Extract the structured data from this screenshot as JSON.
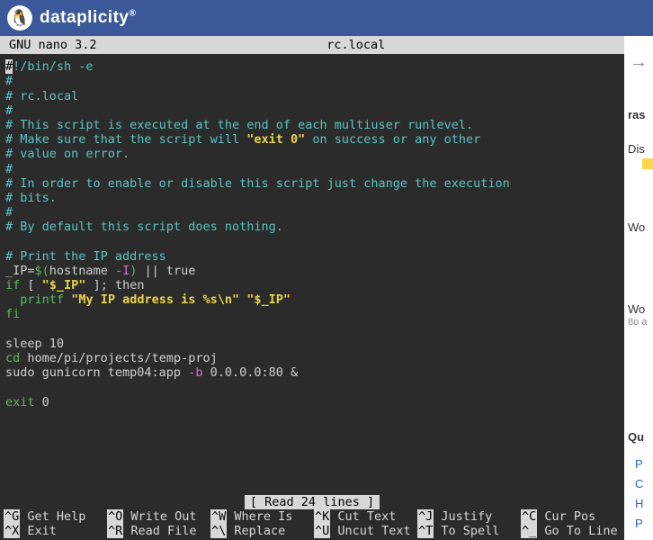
{
  "header": {
    "brand": "dataplicity",
    "reg": "®"
  },
  "titlebar": {
    "left": "GNU nano 3.2",
    "center": "rc.local"
  },
  "editor": {
    "shebang_hash": "#",
    "shebang_rest": "!/bin/sh -e",
    "l2": "#",
    "l3": "# rc.local",
    "l4": "#",
    "l5": "# This script is executed at the end of each multiuser runlevel.",
    "l6a": "# Make sure that the script will ",
    "l6b": "\"exit 0\"",
    "l6c": " on success or any other",
    "l7": "# value on error.",
    "l8": "#",
    "l9": "# In order to enable or disable this script just change the execution",
    "l10": "# bits.",
    "l11": "#",
    "l12": "# By default this script does nothing.",
    "l14": "# Print the IP address",
    "l15_var": "_IP",
    "l15_eq": "=",
    "l15_dollar": "$(",
    "l15_cmd": "hostname ",
    "l15_flag": "-I",
    "l15_close": ")",
    "l15_or": " || ",
    "l15_true": "true",
    "l16_if": "if",
    "l16_bracket": " [ ",
    "l16_var": "\"$_IP\"",
    "l16_rest": " ]; then",
    "l17_indent": "  ",
    "l17_printf": "printf",
    "l17_sp": " ",
    "l17_str1": "\"My IP address is %s\\n\"",
    "l17_sp2": " ",
    "l17_str2": "\"$_IP\"",
    "l18": "fi",
    "l20": "sleep 10",
    "l21_cd": "cd",
    "l21_path": " home/pi/projects/temp-proj",
    "l22a": "sudo gunicorn temp04:app ",
    "l22_flag": "-b",
    "l22b": " 0.0.0.0:80 &",
    "l24_exit": "exit",
    "l24_zero": " 0"
  },
  "status": "[ Read 24 lines ]",
  "shortcuts": {
    "r1": [
      {
        "k": "^G",
        "l": "Get Help"
      },
      {
        "k": "^O",
        "l": "Write Out"
      },
      {
        "k": "^W",
        "l": "Where Is"
      },
      {
        "k": "^K",
        "l": "Cut Text"
      },
      {
        "k": "^J",
        "l": "Justify"
      },
      {
        "k": "^C",
        "l": "Cur Pos"
      }
    ],
    "r2": [
      {
        "k": "^X",
        "l": "Exit"
      },
      {
        "k": "^R",
        "l": "Read File"
      },
      {
        "k": "^\\",
        "l": "Replace"
      },
      {
        "k": "^U",
        "l": "Uncut Text"
      },
      {
        "k": "^T",
        "l": "To Spell"
      },
      {
        "k": "^_",
        "l": "Go To Line"
      }
    ]
  },
  "sidebar": {
    "t1": "ras",
    "t2": "Dis",
    "t3": "Wo",
    "t4": "Wo",
    "t5": "8o a",
    "t6": "Qu",
    "b1": "P",
    "b2": "C",
    "b3": "H",
    "b4": "P"
  }
}
